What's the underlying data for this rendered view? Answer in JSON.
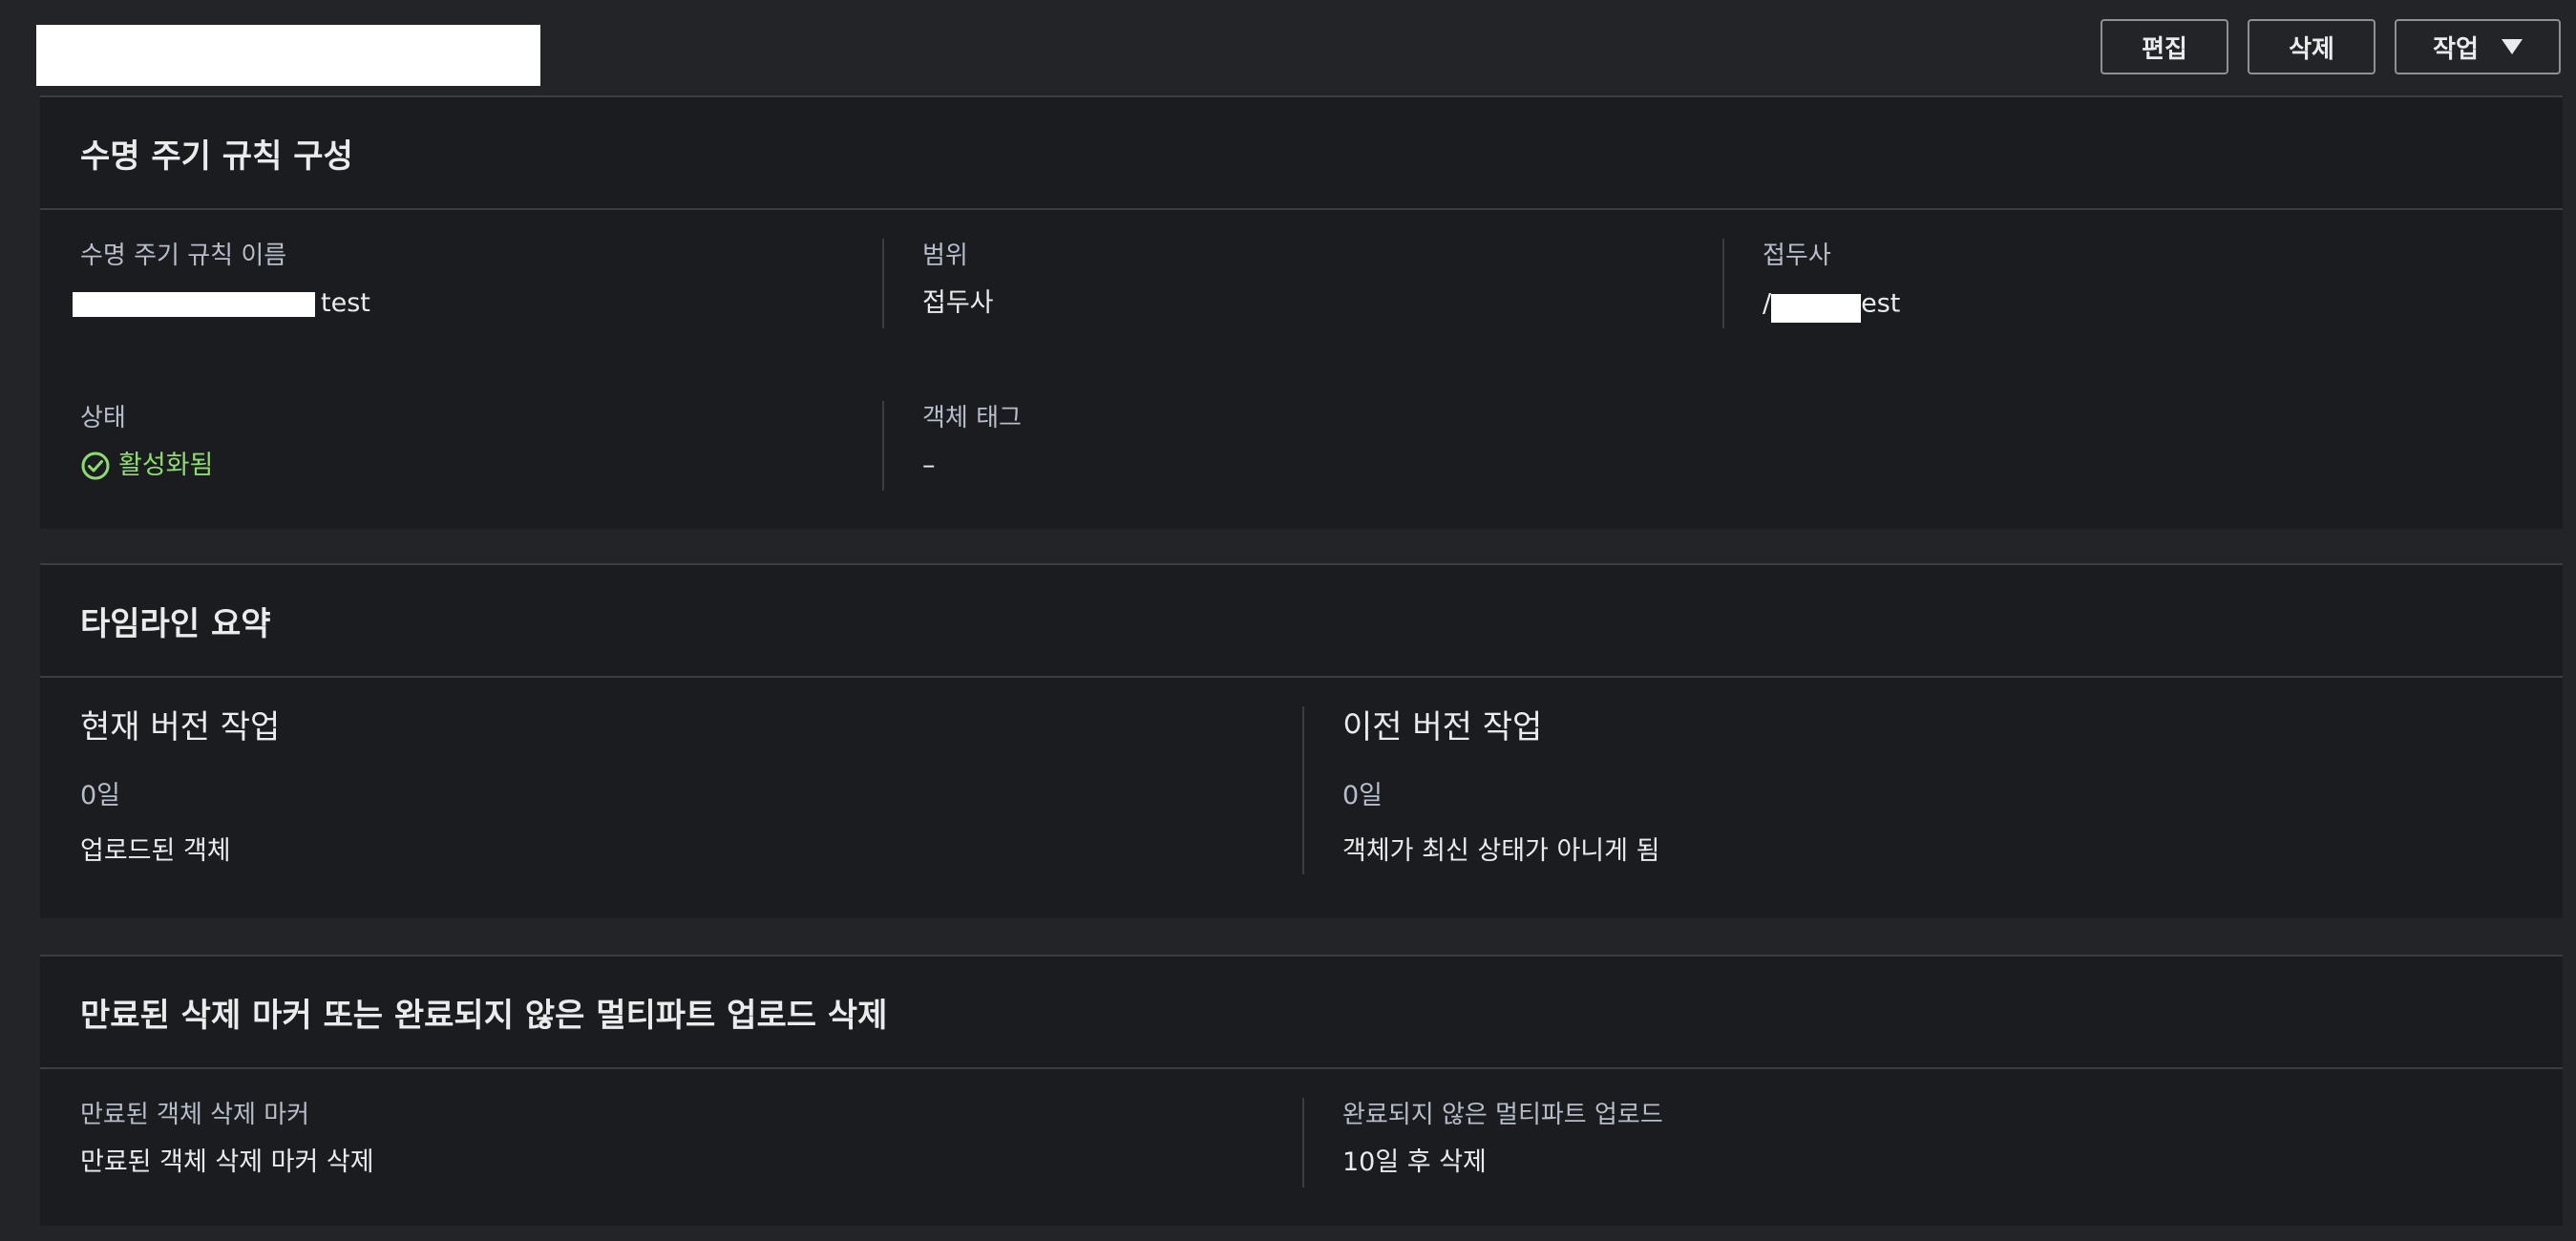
{
  "header": {
    "edit_label": "편집",
    "delete_label": "삭제",
    "actions_label": "작업"
  },
  "config": {
    "title": "수명 주기 규칙 구성",
    "rule_name_label": "수명 주기 규칙 이름",
    "rule_name_value": "test",
    "scope_label": "범위",
    "scope_value": "접두사",
    "prefix_label": "접두사",
    "prefix_value_start": "/",
    "prefix_value_end": "est",
    "status_label": "상태",
    "status_value": "활성화됨",
    "tags_label": "객체 태그",
    "tags_value": "–",
    "status_color": "#8edb6f"
  },
  "timeline": {
    "title": "타임라인 요약",
    "current": {
      "title": "현재 버전 작업",
      "days": "0일",
      "desc": "업로드된 객체"
    },
    "previous": {
      "title": "이전 버전 작업",
      "days": "0일",
      "desc": "객체가 최신 상태가 아니게 됨"
    }
  },
  "expired": {
    "title": "만료된 삭제 마커 또는 완료되지 않은 멀티파트 업로드 삭제",
    "markers_label": "만료된 객체 삭제 마커",
    "markers_value": "만료된 객체 삭제 마커 삭제",
    "multipart_label": "완료되지 않은 멀티파트 업로드",
    "multipart_value": "10일 후 삭제"
  }
}
